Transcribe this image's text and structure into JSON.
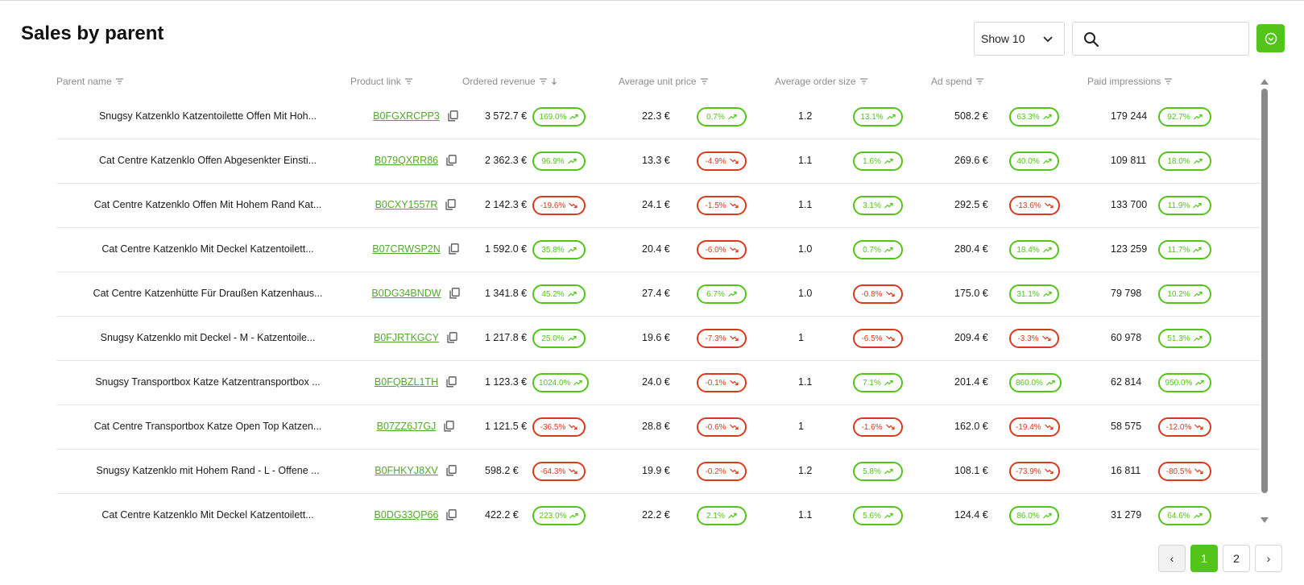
{
  "header": {
    "title": "Sales by parent"
  },
  "controls": {
    "show_label": "Show 10",
    "search_placeholder": "",
    "search_value": ""
  },
  "columns": {
    "parent_name": "Parent name",
    "product_link": "Product link",
    "ordered_revenue": "Ordered revenue",
    "average_unit_price": "Average unit price",
    "average_order_size": "Average order size",
    "ad_spend": "Ad spend",
    "paid_impressions": "Paid impressions"
  },
  "rows": [
    {
      "name": "Snugsy Katzenklo Katzentoilette Offen Mit Hoh...",
      "link": "B0FGXRCPP3",
      "rev": "3 572.7 €",
      "rev_d": "169.0%",
      "rev_t": "up",
      "aup": "22.3 €",
      "aup_d": "0.7%",
      "aup_t": "up",
      "aos": "1.2",
      "aos_d": "13.1%",
      "aos_t": "up",
      "ads": "508.2 €",
      "ads_d": "63.3%",
      "ads_t": "up",
      "imp": "179 244",
      "imp_d": "92.7%",
      "imp_t": "up"
    },
    {
      "name": "Cat Centre Katzenklo Offen Abgesenkter Einsti...",
      "link": "B079QXRR86",
      "rev": "2 362.3 €",
      "rev_d": "96.9%",
      "rev_t": "up",
      "aup": "13.3 €",
      "aup_d": "-4.9%",
      "aup_t": "down",
      "aos": "1.1",
      "aos_d": "1.6%",
      "aos_t": "up",
      "ads": "269.6 €",
      "ads_d": "40.0%",
      "ads_t": "up",
      "imp": "109 811",
      "imp_d": "18.0%",
      "imp_t": "up"
    },
    {
      "name": "Cat Centre Katzenklo Offen Mit Hohem Rand Kat...",
      "link": "B0CXY1557R",
      "rev": "2 142.3 €",
      "rev_d": "-19.6%",
      "rev_t": "down",
      "aup": "24.1 €",
      "aup_d": "-1.5%",
      "aup_t": "down",
      "aos": "1.1",
      "aos_d": "3.1%",
      "aos_t": "up",
      "ads": "292.5 €",
      "ads_d": "-13.6%",
      "ads_t": "down",
      "imp": "133 700",
      "imp_d": "11.9%",
      "imp_t": "up"
    },
    {
      "name": "Cat Centre Katzenklo Mit Deckel Katzentoilett...",
      "link": "B07CRWSP2N",
      "rev": "1 592.0 €",
      "rev_d": "35.8%",
      "rev_t": "up",
      "aup": "20.4 €",
      "aup_d": "-6.0%",
      "aup_t": "down",
      "aos": "1.0",
      "aos_d": "0.7%",
      "aos_t": "up",
      "ads": "280.4 €",
      "ads_d": "18.4%",
      "ads_t": "up",
      "imp": "123 259",
      "imp_d": "11.7%",
      "imp_t": "up"
    },
    {
      "name": "Cat Centre Katzenhütte Für Draußen Katzenhaus...",
      "link": "B0DG34BNDW",
      "rev": "1 341.8 €",
      "rev_d": "45.2%",
      "rev_t": "up",
      "aup": "27.4 €",
      "aup_d": "6.7%",
      "aup_t": "up",
      "aos": "1.0",
      "aos_d": "-0.8%",
      "aos_t": "down",
      "ads": "175.0 €",
      "ads_d": "31.1%",
      "ads_t": "up",
      "imp": "79 798",
      "imp_d": "10.2%",
      "imp_t": "up"
    },
    {
      "name": "Snugsy Katzenklo mit Deckel - M - Katzentoile...",
      "link": "B0FJRTKGCY",
      "rev": "1 217.8 €",
      "rev_d": "25.0%",
      "rev_t": "up",
      "aup": "19.6 €",
      "aup_d": "-7.3%",
      "aup_t": "down",
      "aos": "1",
      "aos_d": "-6.5%",
      "aos_t": "down",
      "ads": "209.4 €",
      "ads_d": "-3.3%",
      "ads_t": "down",
      "imp": "60 978",
      "imp_d": "51.3%",
      "imp_t": "up"
    },
    {
      "name": "Snugsy Transportbox Katze Katzentransportbox ...",
      "link": "B0FQBZL1TH",
      "rev": "1 123.3 €",
      "rev_d": "1024.0%",
      "rev_t": "up",
      "aup": "24.0 €",
      "aup_d": "-0.1%",
      "aup_t": "down",
      "aos": "1.1",
      "aos_d": "7.1%",
      "aos_t": "up",
      "ads": "201.4 €",
      "ads_d": "860.0%",
      "ads_t": "up",
      "imp": "62 814",
      "imp_d": "950.0%",
      "imp_t": "up"
    },
    {
      "name": "Cat Centre Transportbox Katze Open Top Katzen...",
      "link": "B07ZZ6J7GJ",
      "rev": "1 121.5 €",
      "rev_d": "-36.5%",
      "rev_t": "down",
      "aup": "28.8 €",
      "aup_d": "-0.6%",
      "aup_t": "down",
      "aos": "1",
      "aos_d": "-1.6%",
      "aos_t": "down",
      "ads": "162.0 €",
      "ads_d": "-19.4%",
      "ads_t": "down",
      "imp": "58 575",
      "imp_d": "-12.0%",
      "imp_t": "down"
    },
    {
      "name": "Snugsy Katzenklo mit Hohem Rand - L - Offene ...",
      "link": "B0FHKYJ8XV",
      "rev": "598.2 €",
      "rev_d": "-64.3%",
      "rev_t": "down",
      "aup": "19.9 €",
      "aup_d": "-0.2%",
      "aup_t": "down",
      "aos": "1.2",
      "aos_d": "5.8%",
      "aos_t": "up",
      "ads": "108.1 €",
      "ads_d": "-73.9%",
      "ads_t": "down",
      "imp": "16 811",
      "imp_d": "-80.5%",
      "imp_t": "down"
    },
    {
      "name": "Cat Centre Katzenklo Mit Deckel Katzentoilett...",
      "link": "B0DG33QP66",
      "rev": "422.2 €",
      "rev_d": "223.0%",
      "rev_t": "up",
      "aup": "22.2 €",
      "aup_d": "2.1%",
      "aup_t": "up",
      "aos": "1.1",
      "aos_d": "5.6%",
      "aos_t": "up",
      "ads": "124.4 €",
      "ads_d": "86.0%",
      "ads_t": "up",
      "imp": "31 279",
      "imp_d": "64.6%",
      "imp_t": "up"
    }
  ],
  "pagination": {
    "prev": "‹",
    "pages": [
      "1",
      "2"
    ],
    "next": "›",
    "current": "1"
  },
  "colors": {
    "accent": "#52c41a",
    "negative": "#d9391c",
    "link": "#52a82c"
  },
  "icons": {
    "search": "search-icon",
    "chevron": "chevron-down-icon",
    "export": "check-circle-icon",
    "copy": "copy-icon",
    "filter": "filter-icon",
    "trend_up": "trend-up-icon",
    "trend_down": "trend-down-icon"
  }
}
